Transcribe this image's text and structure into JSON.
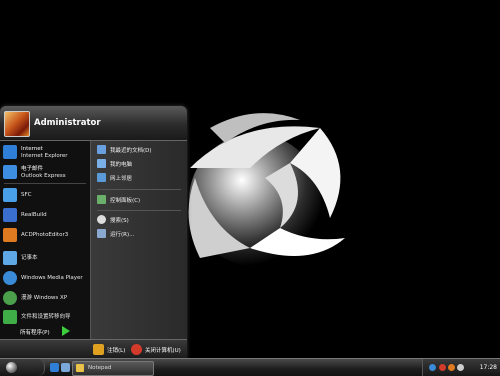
{
  "user": {
    "name": "Administrator"
  },
  "pinned": [
    {
      "line1": "Internet",
      "line2": "Internet Explorer",
      "icon": "internet-explorer-icon",
      "color": "#2f7fd8"
    },
    {
      "line1": "电子邮件",
      "line2": "Outlook Express",
      "icon": "mail-icon",
      "color": "#3d8ee0"
    }
  ],
  "recent": [
    {
      "label": "SFC",
      "icon": "sfc-icon",
      "color": "#4aa0e8"
    },
    {
      "label": "RealBuild",
      "icon": "realbuild-icon",
      "color": "#3a6fd0"
    },
    {
      "label": "ACDPhotoEditor3",
      "icon": "acd-photo-editor-icon",
      "color": "#e07a20"
    },
    {
      "label": "记事本",
      "icon": "notepad-icon",
      "color": "#5fa8e6"
    },
    {
      "label": "Windows Media Player",
      "icon": "media-player-icon",
      "color": "#3a8ad8"
    },
    {
      "label": "漫游 Windows XP",
      "icon": "tour-icon",
      "color": "#4ba04b"
    },
    {
      "label": "文件和设置转移向导",
      "icon": "transfer-wizard-icon",
      "color": "#3fae46"
    }
  ],
  "all_programs": "所有程序(P)",
  "places": [
    {
      "label": "我最近的文档(D)",
      "icon": "recent-docs-icon",
      "color": "#6aa0e0"
    },
    {
      "label": "我的电脑",
      "icon": "my-computer-icon",
      "color": "#7ab0e8"
    },
    {
      "label": "网上邻居",
      "icon": "network-icon",
      "color": "#5a9ad8"
    },
    {
      "label": "控制面板(C)",
      "icon": "control-panel-icon",
      "color": "#6ab06a"
    },
    {
      "label": "搜索(S)",
      "icon": "search-icon",
      "color": "#dddddd"
    },
    {
      "label": "运行(R)...",
      "icon": "run-icon",
      "color": "#8aa8d0"
    }
  ],
  "footer": {
    "logoff": "注销(L)",
    "shutdown": "关闭计算机(U)"
  },
  "taskbar": {
    "task_label": "Notepad",
    "clock": "17:28"
  }
}
